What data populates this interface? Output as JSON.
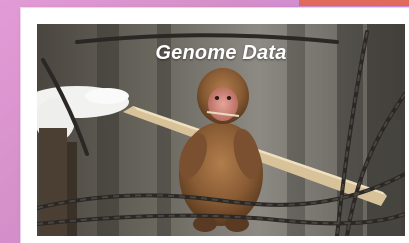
{
  "card": {
    "title": "Genome Data",
    "image_subject": "monkey-on-chain-bridge-photo"
  },
  "colors": {
    "background_gradient_start": "#e29bd6",
    "background_gradient_end": "#b889e8",
    "accent_tab": "#e06a5c",
    "title_text": "#ffffff"
  }
}
